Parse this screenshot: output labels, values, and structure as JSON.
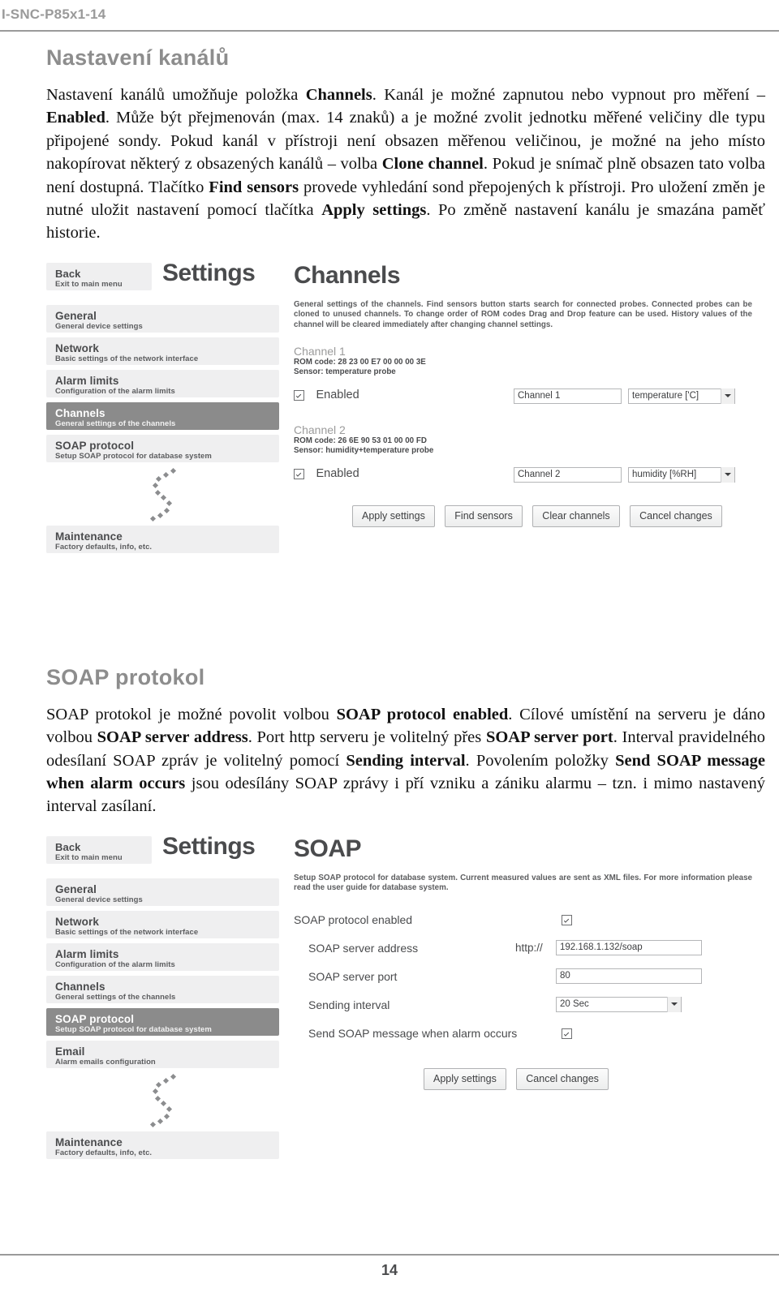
{
  "header": {
    "document_code": "I-SNC-P85x1-14"
  },
  "footer": {
    "page_number": "14"
  },
  "sections": {
    "channels": {
      "title": "Nastavení kanálů",
      "paragraph_html": "Nastavení kanálů umožňuje položka <b>Channels</b>. Kanál je možné zapnutou nebo vypnout pro měření &ndash; <b>Enabled</b>. Může být přejmenován (max. 14 znaků) a je možné zvolit jednotku měřené veličiny dle typu připojené sondy. Pokud kanál v přístroji není obsazen měřenou veličinou, je možné na jeho místo nakopírovat některý z obsazených kanálů &ndash; volba <b>Clone channel</b>. Pokud je snímač plně obsazen tato volba není dostupná. Tlačítko <b>Find sensors</b> provede vyhledání sond přepojených k přístroji. Pro uložení změn je nutné uložit nastavení pomocí tlačítka <b>Apply settings</b>. Po změně nastavení kanálu je smazána paměť historie."
    },
    "soap": {
      "title": "SOAP protokol",
      "paragraph_html": "SOAP protokol je možné povolit volbou <b>SOAP protocol enabled</b>. Cílové umístění na serveru je dáno volbou <b>SOAP server address</b>. Port http serveru je volitelný přes <b>SOAP server port</b>. Interval pravidelného odesílaní SOAP zpráv je volitelný pomocí <b>Sending interval</b>. Povolením položky <b>Send SOAP message when alarm occurs</b> jsou odesílány SOAP zprávy i pří vzniku a zániku alarmu &ndash; tzn. i mimo nastavený interval zasílaní."
    }
  },
  "screenshot_channels": {
    "settings_word": "Settings",
    "back": {
      "title": "Back",
      "subtitle": "Exit to main menu"
    },
    "menu": [
      {
        "title": "General",
        "subtitle": "General device settings",
        "selected": false
      },
      {
        "title": "Network",
        "subtitle": "Basic settings of the network interface",
        "selected": false
      },
      {
        "title": "Alarm limits",
        "subtitle": "Configuration of the alarm limits",
        "selected": false
      },
      {
        "title": "Channels",
        "subtitle": "General settings of the channels",
        "selected": true
      },
      {
        "title": "SOAP protocol",
        "subtitle": "Setup SOAP protocol for database system",
        "selected": false
      }
    ],
    "menu_bottom": {
      "title": "Maintenance",
      "subtitle": "Factory defaults, info, etc."
    },
    "panel_title": "Channels",
    "panel_desc": "General settings of the channels. Find sensors button starts search for connected probes. Connected probes can be cloned to unused channels. To change order of ROM codes Drag and Drop feature can be used. History values of the channel will be cleared immediately after changing channel settings.",
    "channels": [
      {
        "name": "Channel 1",
        "rom_code": "ROM code: 28 23 00 E7 00 00 00 3E",
        "sensor": "Sensor: temperature probe",
        "enabled_label": "Enabled",
        "enabled": true,
        "name_value": "Channel 1",
        "unit_value": "temperature ['C]"
      },
      {
        "name": "Channel 2",
        "rom_code": "ROM code: 26 6E 90 53 01 00 00 FD",
        "sensor": "Sensor: humidity+temperature probe",
        "enabled_label": "Enabled",
        "enabled": true,
        "name_value": "Channel 2",
        "unit_value": "humidity [%RH]"
      }
    ],
    "buttons": [
      "Apply settings",
      "Find sensors",
      "Clear channels",
      "Cancel changes"
    ]
  },
  "screenshot_soap": {
    "settings_word": "Settings",
    "back": {
      "title": "Back",
      "subtitle": "Exit to main menu"
    },
    "menu": [
      {
        "title": "General",
        "subtitle": "General device settings",
        "selected": false
      },
      {
        "title": "Network",
        "subtitle": "Basic settings of the network interface",
        "selected": false
      },
      {
        "title": "Alarm limits",
        "subtitle": "Configuration of the alarm limits",
        "selected": false
      },
      {
        "title": "Channels",
        "subtitle": "General settings of the channels",
        "selected": false
      },
      {
        "title": "SOAP protocol",
        "subtitle": "Setup SOAP protocol for database system",
        "selected": true
      },
      {
        "title": "Email",
        "subtitle": "Alarm emails configuration",
        "selected": false
      }
    ],
    "menu_bottom": {
      "title": "Maintenance",
      "subtitle": "Factory defaults, info, etc."
    },
    "panel_title": "SOAP",
    "panel_desc": "Setup SOAP protocol for database system. Current measured values are sent as XML files. For more information please read the user guide for database system.",
    "fields": {
      "protocol_enabled_label": "SOAP protocol enabled",
      "protocol_enabled": true,
      "server_address_label": "SOAP server address",
      "server_address_prefix": "http://",
      "server_address_value": "192.168.1.132/soap",
      "server_port_label": "SOAP server port",
      "server_port_value": "80",
      "sending_interval_label": "Sending interval",
      "sending_interval_value": "20 Sec",
      "alarm_message_label": "Send SOAP message when alarm occurs",
      "alarm_message_enabled": true
    },
    "buttons": [
      "Apply settings",
      "Cancel changes"
    ]
  },
  "colors": {
    "heading_gray": "#8d8d8d",
    "selected_row": "#8b8b8b",
    "row_bg": "#efeff0"
  }
}
